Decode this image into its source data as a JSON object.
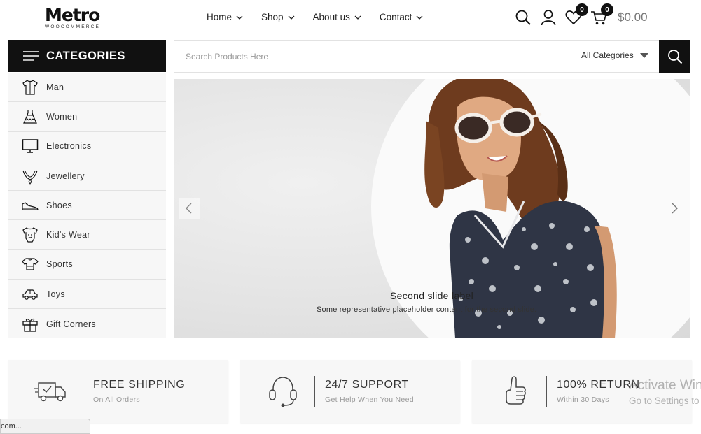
{
  "logo": {
    "main": "Metro",
    "sub": "WOOCOMMERCE"
  },
  "nav": [
    {
      "label": "Home"
    },
    {
      "label": "Shop"
    },
    {
      "label": "About us"
    },
    {
      "label": "Contact"
    }
  ],
  "header": {
    "wishlist_count": "0",
    "cart_count": "0",
    "cart_total": "$0.00"
  },
  "categories": {
    "title": "CATEGORIES",
    "items": [
      {
        "label": "Man",
        "icon": "shirt-icon"
      },
      {
        "label": "Women",
        "icon": "dress-icon"
      },
      {
        "label": "Electronics",
        "icon": "monitor-icon"
      },
      {
        "label": "Jewellery",
        "icon": "necklace-icon"
      },
      {
        "label": "Shoes",
        "icon": "shoe-icon"
      },
      {
        "label": "Kid's Wear",
        "icon": "baby-onesie-icon"
      },
      {
        "label": "Sports",
        "icon": "jersey-icon"
      },
      {
        "label": "Toys",
        "icon": "toy-car-icon"
      },
      {
        "label": "Gift Corners",
        "icon": "gift-icon"
      }
    ]
  },
  "search": {
    "placeholder": "Search Products Here",
    "category_selected": "All Categories"
  },
  "hero": {
    "caption_title": "Second slide label",
    "caption_text": "Some representative placeholder content for the second slide."
  },
  "features": [
    {
      "title": "FREE SHIPPING",
      "subtitle": "On All Orders",
      "icon": "delivery-truck-icon"
    },
    {
      "title": "24/7 SUPPORT",
      "subtitle": "Get Help When You Need",
      "icon": "headset-icon"
    },
    {
      "title": "100% RETURN",
      "subtitle": "Within 30 Days",
      "icon": "thumbs-up-icon"
    }
  ],
  "os_overlay": {
    "line1": "Activate Windows",
    "line2": "Go to Settings to activate Windows."
  },
  "statusbar": {
    "text": "com..."
  },
  "colors": {
    "primary": "#111111",
    "sidebar_bg": "#f7f7f7",
    "muted_text": "#999999"
  }
}
